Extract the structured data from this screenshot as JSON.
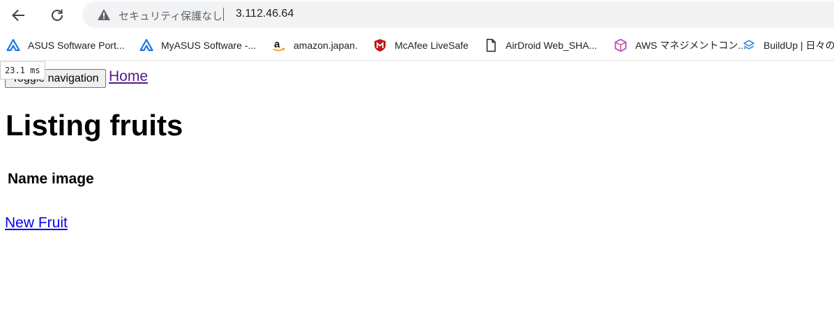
{
  "browser": {
    "security_label": "セキュリティ保護なし",
    "url": "3.112.46.64",
    "bookmarks": [
      {
        "label": "ASUS Software Port...",
        "icon": "asus-triangle-icon"
      },
      {
        "label": "MyASUS Software -...",
        "icon": "asus-triangle-icon"
      },
      {
        "label": "amazon.japan.",
        "icon": "amazon-icon"
      },
      {
        "label": "McAfee LiveSafe",
        "icon": "mcafee-shield-icon"
      },
      {
        "label": "AirDroid Web_SHA...",
        "icon": "document-icon"
      },
      {
        "label": "AWS マネジメントコン...",
        "icon": "aws-cube-icon"
      },
      {
        "label": "BuildUp | 日々の",
        "icon": "buildup-icon"
      }
    ]
  },
  "page": {
    "timing": "23.1 ms",
    "toggle_label": "Toggle navigation",
    "home_link": "Home",
    "title": "Listing fruits",
    "table_header": "Name image",
    "new_link": "New Fruit"
  }
}
